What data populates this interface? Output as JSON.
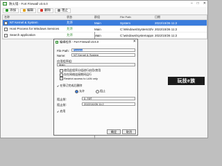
{
  "window": {
    "title": "防火墙 - Fort Firewall v3.6.0"
  },
  "toolbar": [
    {
      "label": "添加",
      "color": "#2e9e2e"
    },
    {
      "label": "编辑",
      "color": "#e0a21f"
    },
    {
      "label": "删除",
      "color": "#d9342b"
    },
    {
      "label": "阻止",
      "color": "#7f7f7f"
    }
  ],
  "grid": {
    "headers": [
      "名称",
      "状态",
      "群组",
      "File Path",
      "日期"
    ],
    "rows": [
      {
        "name": "NT Kernel & System",
        "state": "允许",
        "group": "Main",
        "path": "System",
        "date": "2022/10/26 11:2",
        "selected": true
      },
      {
        "name": "Host Process for Windows Services",
        "state": "允许",
        "group": "Main",
        "path": "C:\\Windows\\System32\\svchost.exe",
        "date": "2022/10/26 11:2",
        "selected": false
      },
      {
        "name": "Search application",
        "state": "允许",
        "group": "Main",
        "path": "C:\\windows\\systemapps\\...\\searchapp.exe",
        "date": "2022/10/26 11:2",
        "selected": false
      }
    ]
  },
  "dialog": {
    "title": "编辑程序 - Fort Firewall v3.6.0",
    "file_path_label": "File Path:",
    "file_path_value": "System",
    "name_label": "Name:",
    "name_value": "NT Kernel & System",
    "group_label": "应用程序组:",
    "group_value": "Main",
    "options": [
      "使用此程序分组进行启用/禁用",
      "仅在网络连接期间运行",
      "Restrict access to LAN only"
    ],
    "schedule_label": "在预订完成后删除",
    "allow_label": "允许",
    "block_label": "阻止",
    "time_label_1": "阻止前:",
    "time_value_1": "5 小时",
    "time_label_2": "阻止前:",
    "time_value_2": "2022/10/26 11:2",
    "enabled_label": "启用",
    "ok": "确定",
    "cancel": "取消"
  },
  "watermark": "玩技e族"
}
